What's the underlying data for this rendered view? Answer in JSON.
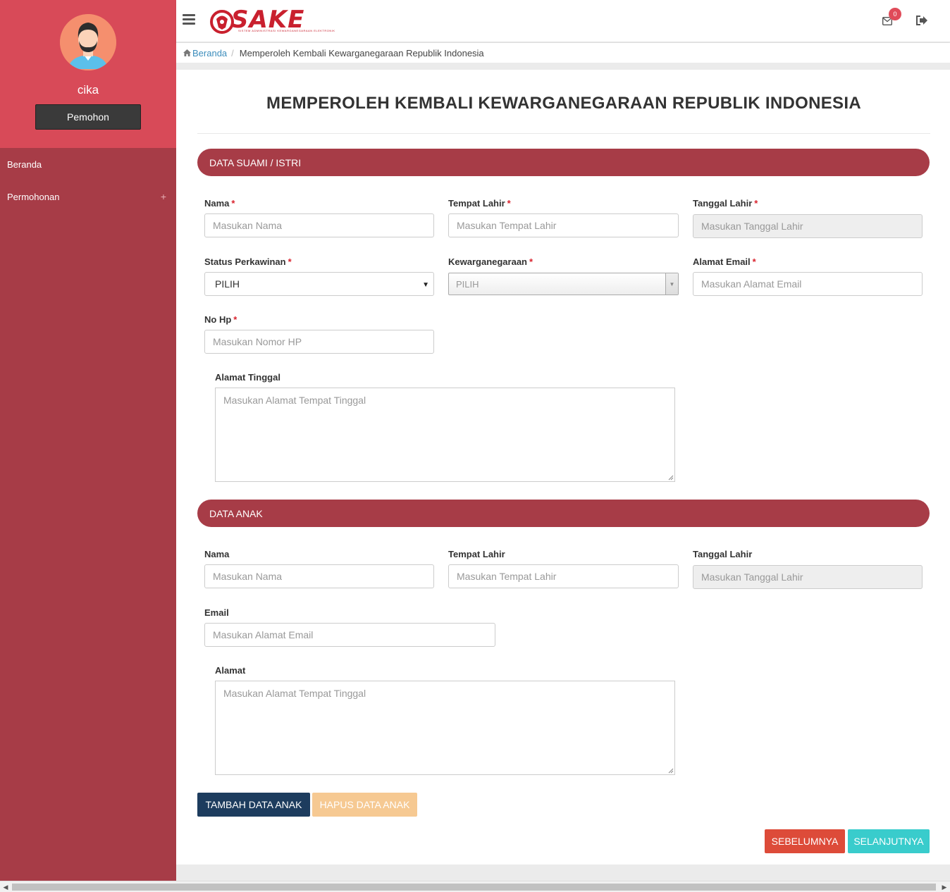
{
  "sidebar": {
    "username": "cika",
    "role": "Pemohon",
    "nav": [
      {
        "label": "Beranda"
      },
      {
        "label": "Permohonan",
        "expander": "+"
      }
    ]
  },
  "topbar": {
    "logo_text": "SAKE",
    "logo_subtitle": "SISTEM ADMINISTRASI KEWARGANEGARAAN ELEKTRONIK",
    "notification_count": "0"
  },
  "breadcrumb": {
    "home": "Beranda",
    "separator": "/",
    "current": "Memperoleh Kembali Kewarganegaraan Republik Indonesia"
  },
  "page": {
    "title": "MEMPEROLEH KEMBALI KEWARGANEGARAAN REPUBLIK INDONESIA"
  },
  "spouse": {
    "heading": "DATA SUAMI / ISTRI",
    "required_mark": "*",
    "nama_label": "Nama",
    "nama_placeholder": "Masukan Nama",
    "tempat_label": "Tempat Lahir",
    "tempat_placeholder": "Masukan Tempat Lahir",
    "tanggal_label": "Tanggal Lahir",
    "tanggal_placeholder": "Masukan Tanggal Lahir",
    "status_label": "Status Perkawinan",
    "status_value": "PILIH",
    "kewarganegaraan_label": "Kewarganegaraan",
    "kewarganegaraan_value": "PILIH",
    "email_label": "Alamat Email",
    "email_placeholder": "Masukan Alamat Email",
    "hp_label": "No Hp",
    "hp_placeholder": "Masukan Nomor HP",
    "alamat_label": "Alamat Tinggal",
    "alamat_placeholder": "Masukan Alamat Tempat Tinggal"
  },
  "child": {
    "heading": "DATA ANAK",
    "nama_label": "Nama",
    "nama_placeholder": "Masukan Nama",
    "tempat_label": "Tempat Lahir",
    "tempat_placeholder": "Masukan Tempat Lahir",
    "tanggal_label": "Tanggal Lahir",
    "tanggal_placeholder": "Masukan Tanggal Lahir",
    "email_label": "Email",
    "email_placeholder": "Masukan Alamat Email",
    "alamat_label": "Alamat",
    "alamat_placeholder": "Masukan Alamat Tempat Tinggal"
  },
  "actions": {
    "add_child": "TAMBAH DATA ANAK",
    "remove_child": "HAPUS DATA ANAK",
    "previous": "SEBELUMNYA",
    "next": "SELANJUTNYA"
  },
  "colors": {
    "sidebar": "#a73c47",
    "profile": "#d84a58",
    "accent": "#a73c47",
    "navy": "#1d3c5e",
    "warning": "#f6c992",
    "danger": "#dd4b39",
    "teal": "#39cccc"
  },
  "icons": {
    "menu": "hamburger-icon",
    "home": "home-icon",
    "mail": "envelope-icon",
    "logout": "sign-out-icon"
  }
}
